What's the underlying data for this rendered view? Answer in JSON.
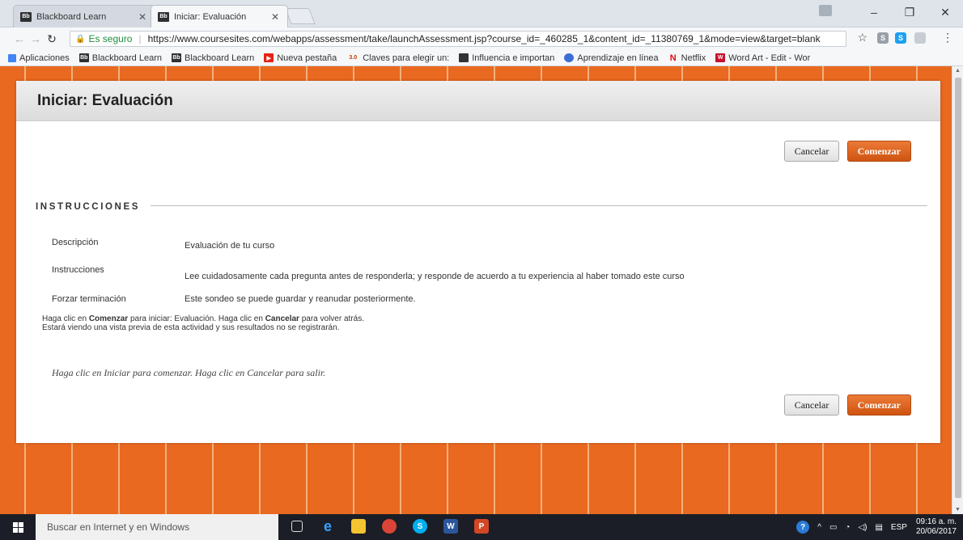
{
  "browser": {
    "tabs": [
      {
        "label": "Blackboard Learn",
        "icon": "Bb"
      },
      {
        "label": "Iniciar: Evaluación",
        "icon": "Bb"
      }
    ],
    "secure_label": "Es seguro",
    "url": "https://www.coursesites.com/webapps/assessment/take/launchAssessment.jsp?course_id=_460285_1&content_id=_11380769_1&mode=view&target=blank",
    "bookmarks": [
      {
        "label": "Aplicaciones",
        "icon": "apps-icon"
      },
      {
        "label": "Blackboard Learn",
        "icon": "Bb"
      },
      {
        "label": "Blackboard Learn",
        "icon": "Bb"
      },
      {
        "label": "Nueva pestaña",
        "icon": "youtube-icon"
      },
      {
        "label": "Claves para elegir un:",
        "icon": "3.0"
      },
      {
        "label": "Influencia e importan",
        "icon": "bookmark-icon"
      },
      {
        "label": "Aprendizaje en línea",
        "icon": "globe-icon"
      },
      {
        "label": "Netflix",
        "icon": "netflix-icon"
      },
      {
        "label": "Word Art - Edit - Wor",
        "icon": "wordart-icon"
      }
    ]
  },
  "page": {
    "title": "Iniciar: Evaluación",
    "cancel_label": "Cancelar",
    "start_label": "Comenzar",
    "section_title": "INSTRUCCIONES",
    "rows": [
      {
        "label": "Descripción",
        "value": "Evaluación de tu curso"
      },
      {
        "label": "Instrucciones",
        "value": "Lee cuidadosamente cada pregunta antes de responderla; y responde de acuerdo a tu experiencia al haber tomado este curso"
      },
      {
        "label": "Forzar terminación",
        "value": "Este sondeo se puede guardar y reanudar posteriormente."
      }
    ],
    "note": {
      "p1": "Haga clic en ",
      "b1": "Comenzar",
      "p2": " para iniciar: Evaluación. Haga clic en ",
      "b2": "Cancelar",
      "p3": " para volver atrás.",
      "line2": "Estará viendo una vista previa de esta actividad y sus resultados no se registrarán."
    },
    "italic_note": "Haga clic en Iniciar para comenzar. Haga clic en Cancelar para salir."
  },
  "taskbar": {
    "search_placeholder": "Buscar en Internet y en Windows",
    "lang": "ESP",
    "time": "09:16 a. m.",
    "date": "20/06/2017"
  },
  "colors": {
    "accent": "#e8691f",
    "start_button": "#d9601b"
  }
}
